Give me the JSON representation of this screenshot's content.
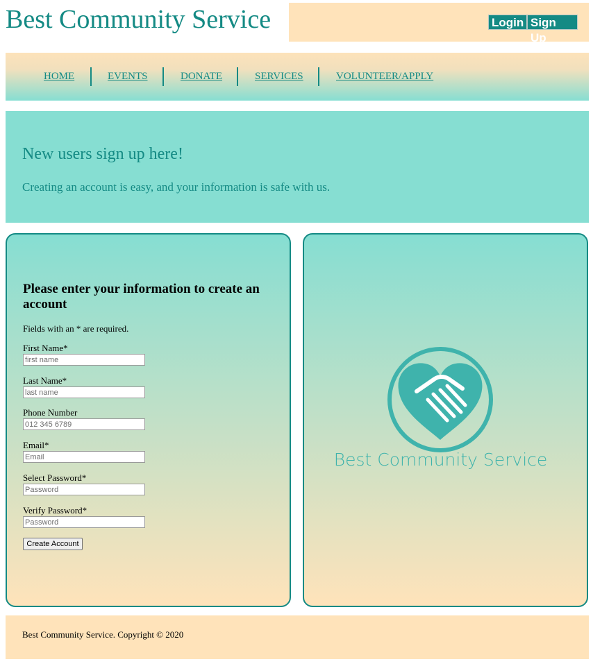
{
  "header": {
    "site_title": "Best Community Service",
    "login_label": "Login",
    "signup_label": "Sign Up"
  },
  "nav": {
    "items": [
      {
        "label": "HOME"
      },
      {
        "label": "EVENTS"
      },
      {
        "label": "DONATE"
      },
      {
        "label": "SERVICES"
      },
      {
        "label": "VOLUNTEER/APPLY"
      }
    ]
  },
  "hero": {
    "title": "New users sign up here!",
    "subtitle": "Creating an account is easy, and your information is safe with us."
  },
  "form": {
    "heading": "Please enter your information to create an account",
    "note": "Fields with an * are required.",
    "fields": [
      {
        "label": "First Name*",
        "placeholder": "first name",
        "value": ""
      },
      {
        "label": "Last Name*",
        "placeholder": "last name",
        "value": ""
      },
      {
        "label": "Phone Number",
        "placeholder": "012 345 6789",
        "value": ""
      },
      {
        "label": "Email*",
        "placeholder": "Email",
        "value": ""
      },
      {
        "label": "Select Password*",
        "placeholder": "Password",
        "value": ""
      },
      {
        "label": "Verify Password*",
        "placeholder": "Password",
        "value": ""
      }
    ],
    "submit_label": "Create Account"
  },
  "logo": {
    "text": "Best Community Service",
    "icon": "heart-handshake-icon"
  },
  "footer": {
    "text": "Best Community Service. Copyright © 2020"
  },
  "colors": {
    "accent": "#148a84",
    "teal_light": "#86ded2",
    "peach": "#ffe3ba",
    "logo": "#3fb3ac"
  }
}
